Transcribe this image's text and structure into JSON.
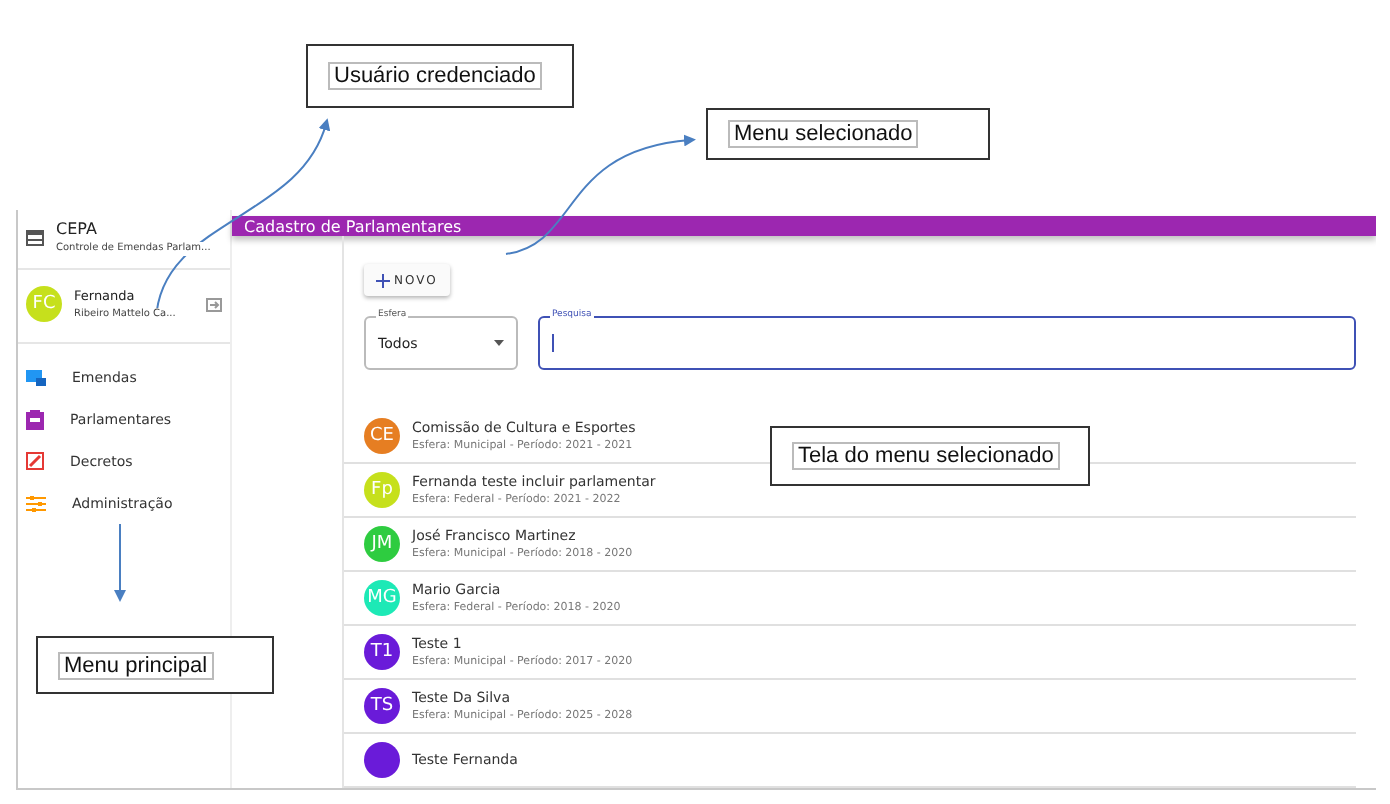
{
  "sidebar": {
    "app_title": "CEPA",
    "app_subtitle": "Controle de Emendas Parlam...",
    "user": {
      "initials": "FC",
      "name": "Fernanda",
      "subtitle": "Ribeiro Mattelo Ca..."
    },
    "items": [
      {
        "label": "Emendas"
      },
      {
        "label": "Parlamentares"
      },
      {
        "label": "Decretos"
      },
      {
        "label": "Administração"
      }
    ]
  },
  "header": {
    "title": "Cadastro de Parlamentares"
  },
  "toolbar": {
    "new_button": "NOVO",
    "sphere_select": {
      "label": "Esfera",
      "value": "Todos"
    },
    "search": {
      "label": "Pesquisa"
    }
  },
  "list": [
    {
      "initials": "CE",
      "color": "#e67e22",
      "name": "Comissão de Cultura e Esportes",
      "detail": "Esfera: Municipal - Período: 2021 - 2021"
    },
    {
      "initials": "Fp",
      "color": "#c6e01c",
      "name": "Fernanda teste incluir parlamentar",
      "detail": "Esfera: Federal - Período: 2021 - 2022"
    },
    {
      "initials": "JM",
      "color": "#2ecc40",
      "name": "José Francisco Martinez",
      "detail": "Esfera: Municipal - Período: 2018 - 2020"
    },
    {
      "initials": "MG",
      "color": "#1de9b6",
      "name": "Mario Garcia",
      "detail": "Esfera: Federal - Período: 2018 - 2020"
    },
    {
      "initials": "T1",
      "color": "#6a1bd9",
      "name": "Teste 1",
      "detail": "Esfera: Municipal - Período: 2017 - 2020"
    },
    {
      "initials": "TS",
      "color": "#6a1bd9",
      "name": "Teste Da Silva",
      "detail": "Esfera: Municipal - Período: 2025 - 2028"
    },
    {
      "color": "#6a1bd9",
      "name": "Teste Fernanda"
    }
  ],
  "annotations": [
    {
      "label": "Usuário credenciado"
    },
    {
      "label": "Menu selecionado"
    },
    {
      "label": "Tela do menu selecionado"
    },
    {
      "label": "Menu principal"
    }
  ]
}
